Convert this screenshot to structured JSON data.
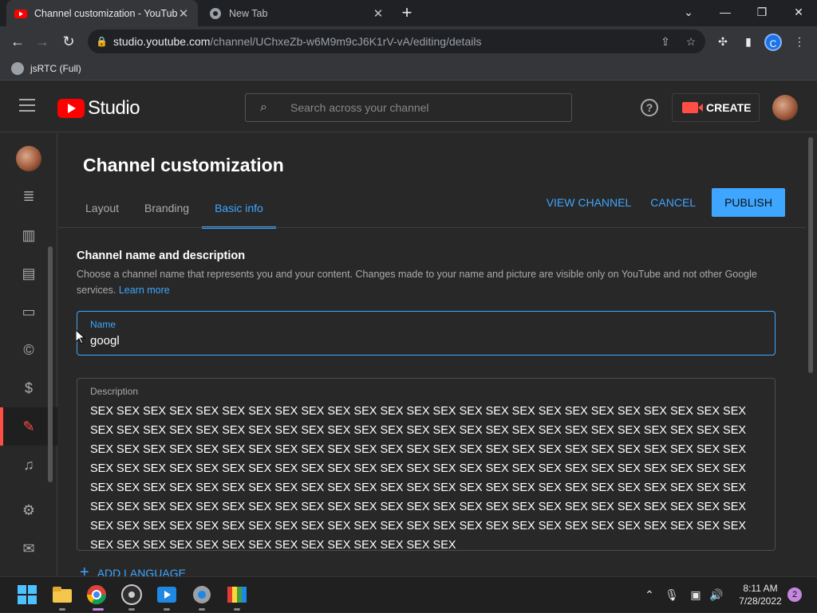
{
  "browser": {
    "tabs": [
      {
        "title": "Channel customization - YouTube",
        "close": "✕"
      },
      {
        "title": "New Tab",
        "close": "✕"
      }
    ],
    "new_tab": "+",
    "window_controls": {
      "dropdown": "⌄",
      "minimize": "—",
      "restore": "❐",
      "close": "✕"
    },
    "nav": {
      "back": "←",
      "forward": "→",
      "reload": "↻"
    },
    "url_host": "studio.youtube.com",
    "url_path": "/channel/UChxeZb-w6M9m9cJ6K1rV-vA/editing/details",
    "profile_initial": "C",
    "bookmarks": [
      {
        "label": "jsRTC (Full)"
      }
    ]
  },
  "studio": {
    "logo_text": "Studio",
    "search_placeholder": "Search across your channel",
    "help": "?",
    "create_label": "CREATE"
  },
  "leftnav": {
    "icons": [
      "content-icon",
      "analytics-icon",
      "comments-icon",
      "subtitles-icon",
      "copyright-icon",
      "monetization-icon",
      "customization-icon",
      "audio-library-icon",
      "settings-icon",
      "feedback-icon"
    ],
    "active": "customization-icon"
  },
  "page": {
    "title": "Channel customization",
    "tabs": [
      {
        "label": "Layout",
        "selected": false
      },
      {
        "label": "Branding",
        "selected": false
      },
      {
        "label": "Basic info",
        "selected": true
      }
    ],
    "actions": {
      "view_channel": "VIEW CHANNEL",
      "cancel": "CANCEL",
      "publish": "PUBLISH"
    },
    "section": {
      "title": "Channel name and description",
      "description": "Choose a channel name that represents you and your content. Changes made to your name and picture are visible only on YouTube and not other Google services.",
      "learn_more": "Learn more"
    },
    "name_field": {
      "label": "Name",
      "value": "googl"
    },
    "description_field": {
      "label": "Description",
      "value": "SEX SEX SEX SEX SEX SEX SEX SEX SEX SEX SEX SEX SEX SEX SEX SEX SEX SEX SEX SEX SEX SEX SEX SEX SEX SEX SEX SEX SEX SEX SEX SEX SEX SEX SEX SEX SEX SEX SEX SEX SEX SEX SEX SEX SEX SEX SEX SEX SEX SEX SEX SEX SEX SEX SEX SEX SEX SEX SEX SEX SEX SEX SEX SEX SEX SEX SEX SEX SEX SEX SEX SEX SEX SEX SEX SEX SEX SEX SEX SEX SEX SEX SEX SEX SEX SEX SEX SEX SEX SEX SEX SEX SEX SEX SEX SEX SEX SEX SEX SEX SEX SEX SEX SEX SEX SEX SEX SEX SEX SEX SEX SEX SEX SEX SEX SEX SEX SEX SEX SEX SEX SEX SEX SEX SEX SEX SEX SEX SEX SEX SEX SEX SEX SEX SEX SEX SEX SEX SEX SEX SEX SEX SEX SEX SEX SEX SEX SEX SEX SEX SEX SEX SEX SEX SEX SEX SEX SEX SEX SEX SEX SEX SEX SEX SEX SEX SEX SEX SEX SEX SEX SEX SEX SEX SEX SEX SEX SEX SEX SEX SEX SEX SEX SEX SEX SEX SEX SEX SEX"
    },
    "add_language": "ADD LANGUAGE"
  },
  "taskbar": {
    "apps": [
      "windows-start-icon",
      "file-explorer-icon",
      "chrome-icon",
      "obs-icon",
      "media-player-icon",
      "settings-icon",
      "paint-icon"
    ],
    "time": "8:11 AM",
    "date": "7/28/2022",
    "notifications": "2"
  },
  "colors": {
    "accent": "#3ea6ff",
    "brand_red": "#ff0000",
    "background": "#282828"
  }
}
